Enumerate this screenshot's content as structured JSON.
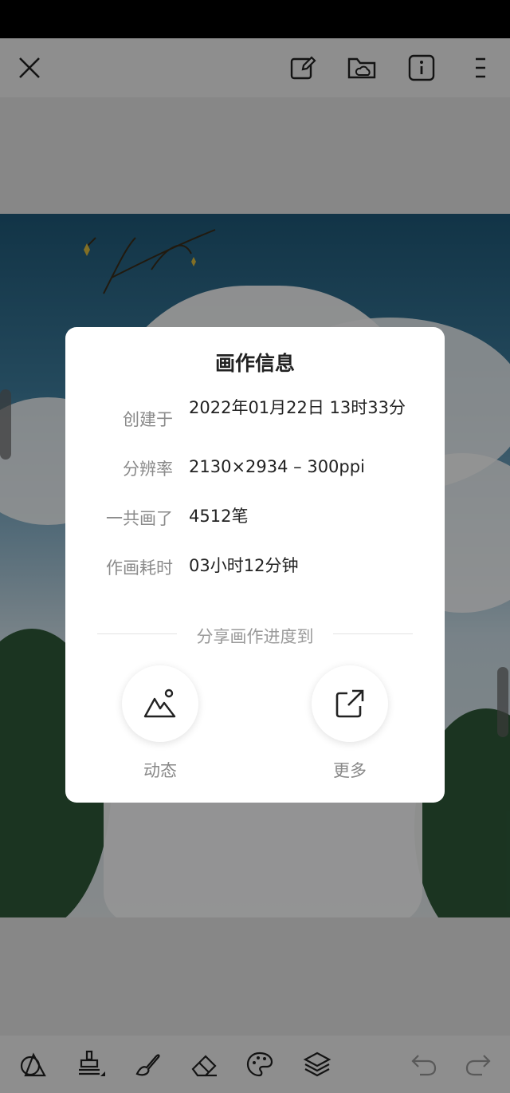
{
  "toolbar": {
    "icons": [
      "close-icon",
      "canvas-edit-icon",
      "cloud-folder-icon",
      "info-icon",
      "menu-icon"
    ]
  },
  "bottom_toolbar": {
    "icons": [
      "shapes-icon",
      "stamp-icon",
      "brush-icon",
      "eraser-icon",
      "palette-icon",
      "layers-icon",
      "undo-icon",
      "redo-icon"
    ]
  },
  "dialog": {
    "title": "画作信息",
    "rows": [
      {
        "label": "创建于",
        "value": "2022年01月22日 13时33分"
      },
      {
        "label": "分辨率",
        "value": "2130×2934 – 300ppi"
      },
      {
        "label": "一共画了",
        "value": "4512笔"
      },
      {
        "label": "作画耗时",
        "value": "03小时12分钟"
      }
    ],
    "share_heading": "分享画作进度到",
    "share": [
      {
        "label": "动态",
        "icon": "image-icon"
      },
      {
        "label": "更多",
        "icon": "external-link-icon"
      }
    ]
  }
}
